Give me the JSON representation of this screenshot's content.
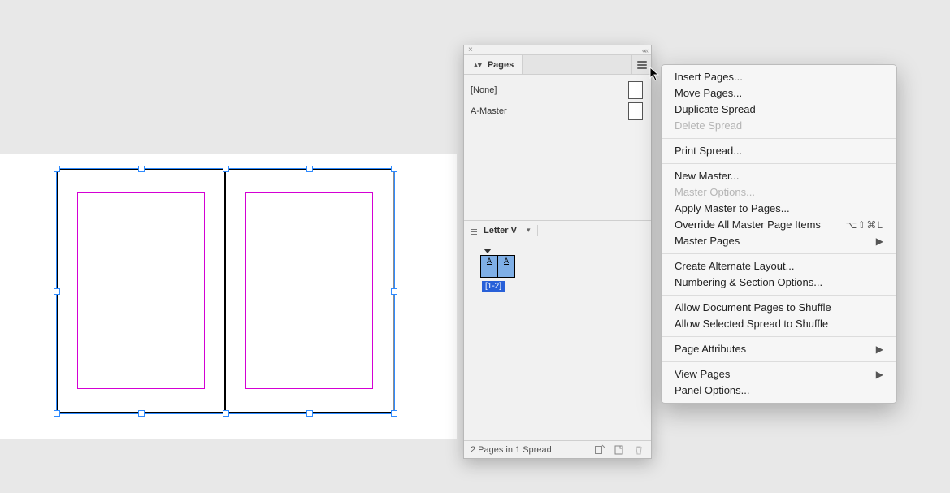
{
  "panel": {
    "title": "Pages",
    "masters": [
      {
        "name": "[None]",
        "thumb": true
      },
      {
        "name": "A-Master",
        "thumb": true
      }
    ],
    "layout_name": "Letter V",
    "spread_thumb": {
      "left_label": "A",
      "right_label": "A",
      "range_label": "[1-2]"
    },
    "footer_status": "2 Pages in 1 Spread"
  },
  "menu": {
    "groups": [
      [
        {
          "label": "Insert Pages...",
          "enabled": true
        },
        {
          "label": "Move Pages...",
          "enabled": true
        },
        {
          "label": "Duplicate Spread",
          "enabled": true
        },
        {
          "label": "Delete Spread",
          "enabled": false
        }
      ],
      [
        {
          "label": "Print Spread...",
          "enabled": true
        }
      ],
      [
        {
          "label": "New Master...",
          "enabled": true
        },
        {
          "label": "Master Options...",
          "enabled": false
        },
        {
          "label": "Apply Master to Pages...",
          "enabled": true
        },
        {
          "label": "Override All Master Page Items",
          "enabled": true,
          "shortcut": "⌥⇧⌘L"
        },
        {
          "label": "Master Pages",
          "enabled": true,
          "submenu": true
        }
      ],
      [
        {
          "label": "Create Alternate Layout...",
          "enabled": true
        },
        {
          "label": "Numbering & Section Options...",
          "enabled": true
        }
      ],
      [
        {
          "label": "Allow Document Pages to Shuffle",
          "enabled": true
        },
        {
          "label": "Allow Selected Spread to Shuffle",
          "enabled": true
        }
      ],
      [
        {
          "label": "Page Attributes",
          "enabled": true,
          "submenu": true
        }
      ],
      [
        {
          "label": "View Pages",
          "enabled": true,
          "submenu": true
        },
        {
          "label": "Panel Options...",
          "enabled": true
        }
      ]
    ]
  }
}
